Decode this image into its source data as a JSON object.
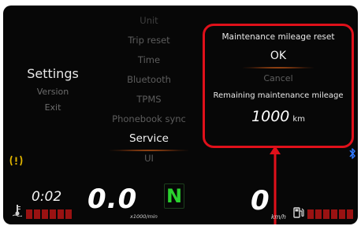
{
  "settings_menu": {
    "items": [
      {
        "label": "Settings",
        "active": true
      },
      {
        "label": "Version",
        "active": false
      },
      {
        "label": "Exit",
        "active": false
      }
    ]
  },
  "submenu": {
    "items": [
      {
        "label": "Unit"
      },
      {
        "label": "Trip reset"
      },
      {
        "label": "Time"
      },
      {
        "label": "Bluetooth"
      },
      {
        "label": "TPMS"
      },
      {
        "label": "Phonebook sync"
      },
      {
        "label": "Service",
        "selected": true
      },
      {
        "label": "UI"
      }
    ]
  },
  "popup": {
    "title": "Maintenance mileage reset",
    "ok_label": "OK",
    "cancel_label": "Cancel",
    "remaining_label": "Remaining maintenance mileage",
    "remaining_value": "1000",
    "remaining_unit": "km",
    "highlight_color": "#e0101a"
  },
  "cluster": {
    "clock": "0:02",
    "rpm_value": "0.0",
    "rpm_unit": "x1000/min",
    "gear": "N",
    "speed_value": "0",
    "speed_unit": "km/h",
    "temp_icon": "coolant-temperature-icon",
    "fuel_icon": "fuel-pump-icon",
    "warning_icon": "tire-pressure-warning-icon",
    "bluetooth_icon": "bluetooth-icon",
    "gear_color": "#2ad22f",
    "bar_color": "#9a1212"
  }
}
